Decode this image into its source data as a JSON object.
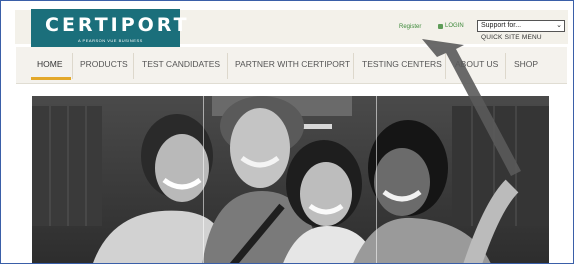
{
  "header": {
    "logo_text": "CERTIPORT",
    "logo_subtext": "A PEARSON VUE BUSINESS",
    "register_label": "Register",
    "login_label": "LOGIN",
    "support_select": "Support for...",
    "quick_site_menu": "QUICK SITE MENU"
  },
  "nav": {
    "items": [
      {
        "label": "HOME"
      },
      {
        "label": "PRODUCTS"
      },
      {
        "label": "TEST CANDIDATES"
      },
      {
        "label": "PARTNER WITH CERTIPORT"
      },
      {
        "label": "TESTING CENTERS"
      },
      {
        "label": "ABOUT US"
      },
      {
        "label": "SHOP"
      }
    ],
    "active": "HOME"
  },
  "hero": {
    "description_icon": "hero-photo",
    "colors": {
      "accent": "#e3a82a",
      "brand": "#1b6f7b",
      "link": "#3d8a3a"
    }
  },
  "annotation": {
    "icon": "pointer-arrow-icon"
  }
}
